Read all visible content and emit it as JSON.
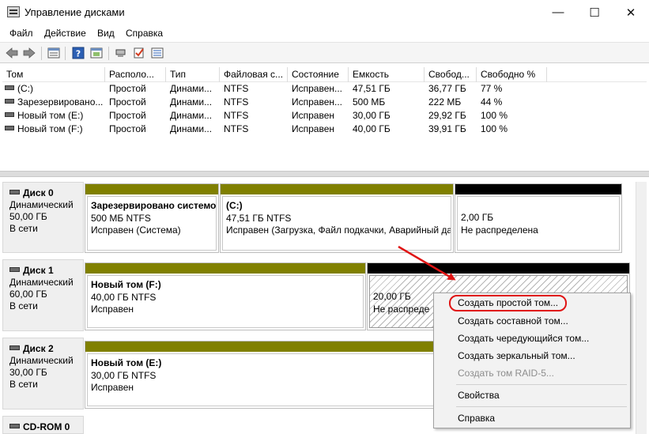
{
  "window": {
    "title": "Управление дисками",
    "minimize_glyph": "—",
    "maximize_glyph": "☐",
    "close_glyph": "✕"
  },
  "menu": [
    "Файл",
    "Действие",
    "Вид",
    "Справка"
  ],
  "toolbar": {
    "icons": [
      "back-icon",
      "forward-icon",
      "list-icon",
      "help-icon",
      "properties-icon",
      "connect-icon",
      "checkmark-icon",
      "settings-list-icon"
    ]
  },
  "volumes": {
    "columns": [
      "Том",
      "Располо...",
      "Тип",
      "Файловая с...",
      "Состояние",
      "Емкость",
      "Свобод...",
      "Свободно %"
    ],
    "rows": [
      [
        "(C:)",
        "Простой",
        "Динами...",
        "NTFS",
        "Исправен...",
        "47,51 ГБ",
        "36,77 ГБ",
        "77 %"
      ],
      [
        "Зарезервировано...",
        "Простой",
        "Динами...",
        "NTFS",
        "Исправен...",
        "500 МБ",
        "222 МБ",
        "44 %"
      ],
      [
        "Новый том (E:)",
        "Простой",
        "Динами...",
        "NTFS",
        "Исправен",
        "30,00 ГБ",
        "29,92 ГБ",
        "100 %"
      ],
      [
        "Новый том (F:)",
        "Простой",
        "Динами...",
        "NTFS",
        "Исправен",
        "40,00 ГБ",
        "39,91 ГБ",
        "100 %"
      ]
    ]
  },
  "disks": [
    {
      "name": "Диск 0",
      "kind": "Динамический",
      "size": "50,00 ГБ",
      "status": "В сети",
      "partitions": [
        {
          "title": "Зарезервировано системо",
          "size": "500 МБ NTFS",
          "state": "Исправен (Система)"
        },
        {
          "title": "(C:)",
          "size": "47,51 ГБ NTFS",
          "state": "Исправен (Загрузка, Файл подкачки, Аварийный дам"
        },
        {
          "title": "",
          "size": "2,00 ГБ",
          "state": "Не распределена"
        }
      ]
    },
    {
      "name": "Диск 1",
      "kind": "Динамический",
      "size": "60,00 ГБ",
      "status": "В сети",
      "partitions": [
        {
          "title": "Новый том  (F:)",
          "size": "40,00 ГБ NTFS",
          "state": "Исправен"
        },
        {
          "title": "",
          "size": "20,00 ГБ",
          "state": "Не распреде"
        }
      ]
    },
    {
      "name": "Диск 2",
      "kind": "Динамический",
      "size": "30,00 ГБ",
      "status": "В сети",
      "partitions": [
        {
          "title": "Новый том  (E:)",
          "size": "30,00 ГБ NTFS",
          "state": "Исправен"
        }
      ]
    },
    {
      "name": "CD-ROM 0"
    }
  ],
  "context_menu": {
    "items": [
      {
        "label": "Создать простой том...",
        "enabled": true
      },
      {
        "label": "Создать составной том...",
        "enabled": true
      },
      {
        "label": "Создать чередующийся том...",
        "enabled": true
      },
      {
        "label": "Создать зеркальный том...",
        "enabled": true
      },
      {
        "label": "Создать том RAID-5...",
        "enabled": false
      },
      {
        "label": "Свойства",
        "enabled": true
      },
      {
        "label": "Справка",
        "enabled": true
      }
    ]
  },
  "colors": {
    "allocated_bar": "#808000",
    "unallocated_bar": "#000000",
    "annotation": "#e01414"
  }
}
